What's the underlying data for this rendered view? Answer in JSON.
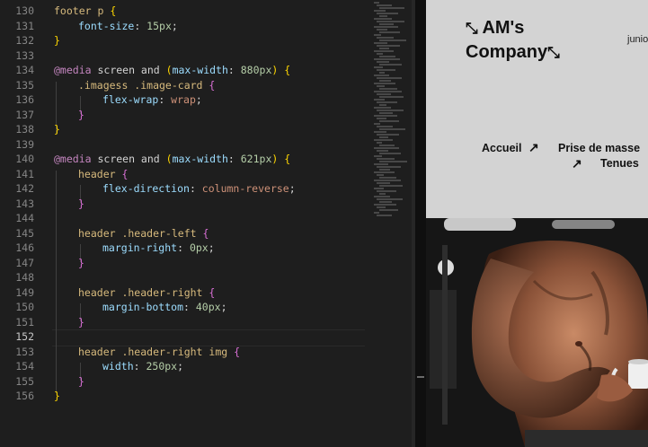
{
  "editor": {
    "line_numbers": [
      "130",
      "131",
      "132",
      "133",
      "134",
      "135",
      "136",
      "137",
      "138",
      "139",
      "140",
      "141",
      "142",
      "143",
      "144",
      "145",
      "146",
      "147",
      "148",
      "149",
      "150",
      "151",
      "152",
      "153",
      "154",
      "155",
      "156"
    ],
    "active_line": "152",
    "code": [
      {
        "ln": "130",
        "indent": 0,
        "tokens": [
          {
            "t": "footer p",
            "c": "s"
          },
          {
            "t": " "
          },
          {
            "t": "{",
            "c": "b1"
          }
        ]
      },
      {
        "ln": "131",
        "indent": 1,
        "tokens": [
          {
            "t": "font-size",
            "c": "p"
          },
          {
            "t": ": "
          },
          {
            "t": "15px",
            "c": "n"
          },
          {
            "t": ";"
          }
        ]
      },
      {
        "ln": "132",
        "indent": 0,
        "tokens": [
          {
            "t": "}",
            "c": "b1"
          }
        ]
      },
      {
        "ln": "133",
        "indent": 0,
        "tokens": []
      },
      {
        "ln": "134",
        "indent": 0,
        "tokens": [
          {
            "t": "@media",
            "c": "at"
          },
          {
            "t": " screen and "
          },
          {
            "t": "(",
            "c": "b1"
          },
          {
            "t": "max-width",
            "c": "p"
          },
          {
            "t": ": "
          },
          {
            "t": "880px",
            "c": "n"
          },
          {
            "t": ")",
            "c": "b1"
          },
          {
            "t": " "
          },
          {
            "t": "{",
            "c": "b1"
          }
        ]
      },
      {
        "ln": "135",
        "indent": 1,
        "tokens": [
          {
            "t": ".imagess .image-card",
            "c": "s"
          },
          {
            "t": " "
          },
          {
            "t": "{",
            "c": "b2"
          }
        ]
      },
      {
        "ln": "136",
        "indent": 2,
        "tokens": [
          {
            "t": "flex-wrap",
            "c": "p"
          },
          {
            "t": ": "
          },
          {
            "t": "wrap",
            "c": "v"
          },
          {
            "t": ";"
          }
        ]
      },
      {
        "ln": "137",
        "indent": 1,
        "tokens": [
          {
            "t": "}",
            "c": "b2"
          }
        ]
      },
      {
        "ln": "138",
        "indent": 0,
        "tokens": [
          {
            "t": "}",
            "c": "b1"
          }
        ]
      },
      {
        "ln": "139",
        "indent": 0,
        "tokens": []
      },
      {
        "ln": "140",
        "indent": 0,
        "tokens": [
          {
            "t": "@media",
            "c": "at"
          },
          {
            "t": " screen and "
          },
          {
            "t": "(",
            "c": "b1"
          },
          {
            "t": "max-width",
            "c": "p"
          },
          {
            "t": ": "
          },
          {
            "t": "621px",
            "c": "n"
          },
          {
            "t": ")",
            "c": "b1"
          },
          {
            "t": " "
          },
          {
            "t": "{",
            "c": "b1"
          }
        ]
      },
      {
        "ln": "141",
        "indent": 1,
        "tokens": [
          {
            "t": "header",
            "c": "s"
          },
          {
            "t": " "
          },
          {
            "t": "{",
            "c": "b2"
          }
        ]
      },
      {
        "ln": "142",
        "indent": 2,
        "tokens": [
          {
            "t": "flex-direction",
            "c": "p"
          },
          {
            "t": ": "
          },
          {
            "t": "column-reverse",
            "c": "v"
          },
          {
            "t": ";"
          }
        ]
      },
      {
        "ln": "143",
        "indent": 1,
        "tokens": [
          {
            "t": "}",
            "c": "b2"
          }
        ]
      },
      {
        "ln": "144",
        "indent": 0,
        "tokens": []
      },
      {
        "ln": "145",
        "indent": 1,
        "tokens": [
          {
            "t": "header .header-left",
            "c": "s"
          },
          {
            "t": " "
          },
          {
            "t": "{",
            "c": "b2"
          }
        ]
      },
      {
        "ln": "146",
        "indent": 2,
        "tokens": [
          {
            "t": "margin-right",
            "c": "p"
          },
          {
            "t": ": "
          },
          {
            "t": "0px",
            "c": "n"
          },
          {
            "t": ";"
          }
        ]
      },
      {
        "ln": "147",
        "indent": 1,
        "tokens": [
          {
            "t": "}",
            "c": "b2"
          }
        ]
      },
      {
        "ln": "148",
        "indent": 0,
        "tokens": []
      },
      {
        "ln": "149",
        "indent": 1,
        "tokens": [
          {
            "t": "header .header-right",
            "c": "s"
          },
          {
            "t": " "
          },
          {
            "t": "{",
            "c": "b2"
          }
        ]
      },
      {
        "ln": "150",
        "indent": 2,
        "tokens": [
          {
            "t": "margin-bottom",
            "c": "p"
          },
          {
            "t": ": "
          },
          {
            "t": "40px",
            "c": "n"
          },
          {
            "t": ";"
          }
        ]
      },
      {
        "ln": "151",
        "indent": 1,
        "tokens": [
          {
            "t": "}",
            "c": "b2"
          }
        ]
      },
      {
        "ln": "152",
        "indent": 0,
        "tokens": []
      },
      {
        "ln": "153",
        "indent": 1,
        "tokens": [
          {
            "t": "header .header-right img",
            "c": "s"
          },
          {
            "t": " "
          },
          {
            "t": "{",
            "c": "b2"
          }
        ]
      },
      {
        "ln": "154",
        "indent": 2,
        "tokens": [
          {
            "t": "width",
            "c": "p"
          },
          {
            "t": ": "
          },
          {
            "t": "250px",
            "c": "n"
          },
          {
            "t": ";"
          }
        ]
      },
      {
        "ln": "155",
        "indent": 1,
        "tokens": [
          {
            "t": "}",
            "c": "b2"
          }
        ]
      },
      {
        "ln": "156",
        "indent": 0,
        "tokens": [
          {
            "t": "}",
            "c": "b1"
          }
        ]
      }
    ]
  },
  "preview": {
    "logo_line1": "AM's",
    "logo_line2": "Company",
    "logo_icon": "expand-arrows-icon",
    "header_right_text": "junio",
    "nav": {
      "accueil": "Accueil",
      "prise_de_masse": "Prise de masse",
      "tenues": "Tenues"
    },
    "nav_arrow_icon": "arrow-up-right-icon",
    "hero_image": "bodybuilder-drinking-coffee-photo"
  },
  "colors": {
    "editor_bg": "#1e1e1e",
    "selector": "#d7ba7d",
    "property": "#9cdcfe",
    "number": "#b5cea8",
    "string_value": "#ce9178",
    "bracket_gold": "#ffd700",
    "bracket_purple": "#da70d6",
    "preview_bg": "#d3d3d3"
  }
}
